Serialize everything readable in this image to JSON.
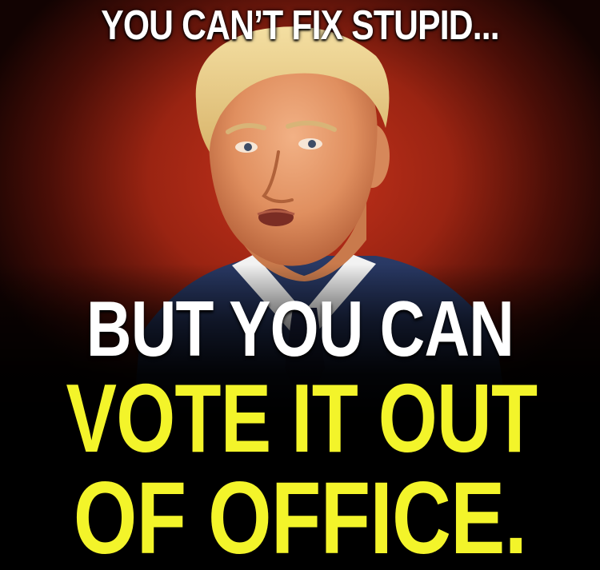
{
  "poster": {
    "top_text": "YOU CAN’T FIX STUPID...",
    "middle_text": "BUT YOU CAN",
    "line_vote": "VOTE IT OUT",
    "line_office": "OF OFFICE."
  },
  "colors": {
    "background": "#000000",
    "backdrop_red": "#c8321c",
    "headline_white": "#ffffff",
    "highlight_yellow": "#f3f42a",
    "suit_navy": "#1d2a4d"
  },
  "icons": {
    "portrait": "man-portrait-photo"
  }
}
